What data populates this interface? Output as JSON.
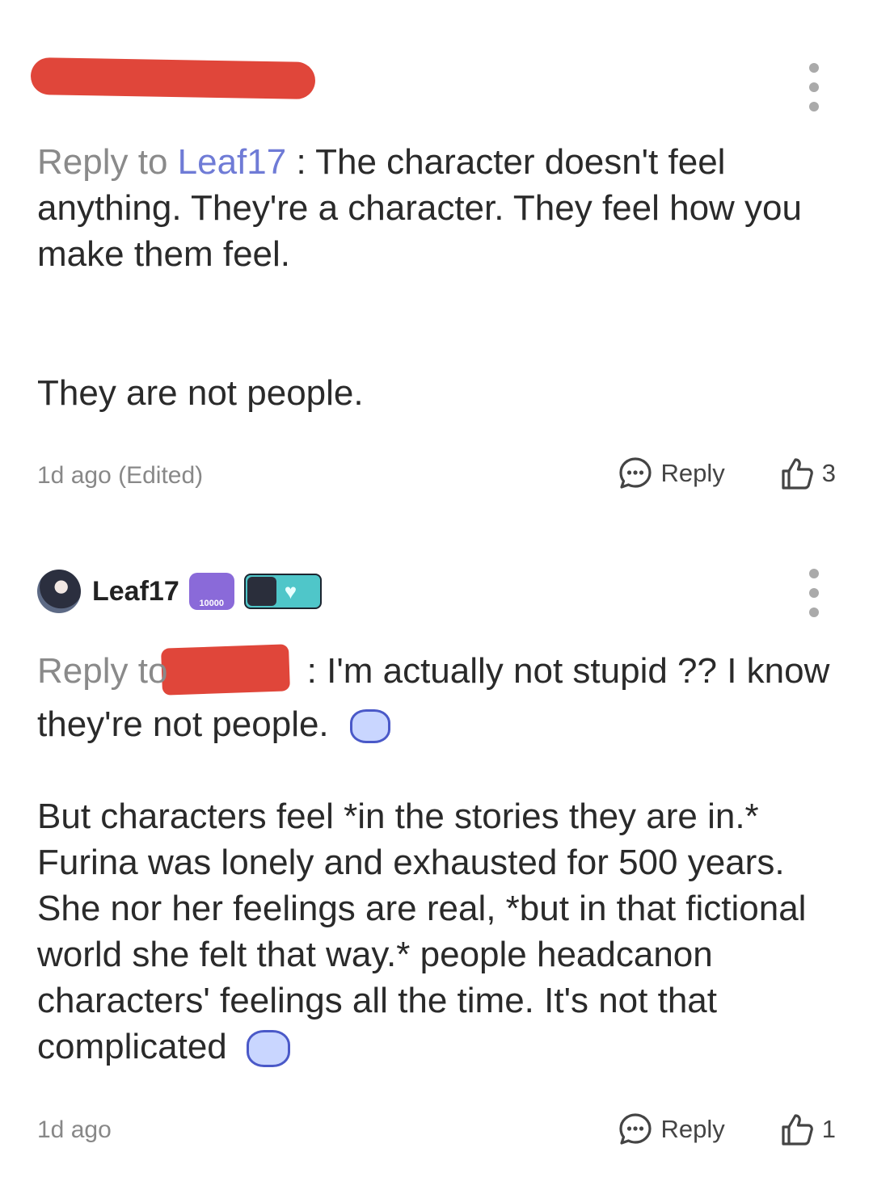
{
  "comment1": {
    "reply_prefix": "Reply to ",
    "reply_target": "Leaf17",
    "text_line": " : The character doesn't feel anything. They're a character. They feel how you make them feel.",
    "text_second": "They are not people.",
    "timestamp": "1d ago (Edited)",
    "reply_label": "Reply",
    "likes": "3"
  },
  "comment2": {
    "username": "Leaf17",
    "badge_level": "10000",
    "reply_prefix": "Reply to",
    "text_line": " : I'm actually not stupid ?? I know they're not people.",
    "paragraph": "But characters feel *in the stories they are in.* Furina was lonely and exhausted for 500 years. She nor her feelings are real, *but in that fictional world she felt that way.* people headcanon characters' feelings all the time. It's not that complicated",
    "timestamp": "1d ago",
    "reply_label": "Reply",
    "likes": "1"
  },
  "colors": {
    "link": "#6f7bd6",
    "redaction": "#e0463a",
    "muted": "#8a8a8a"
  }
}
